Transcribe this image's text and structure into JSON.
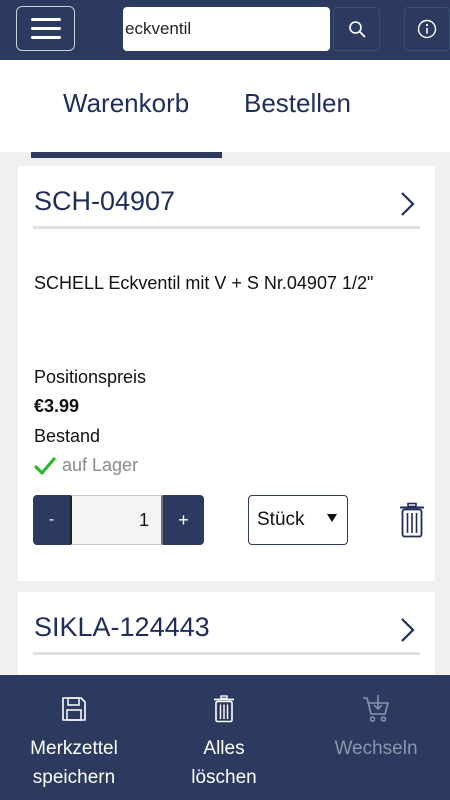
{
  "header": {
    "search": {
      "value": "eckventil",
      "placeholder": ""
    },
    "icons": {
      "menu": "hamburger-icon",
      "search": "search-icon",
      "info": "info-icon"
    }
  },
  "tabs": [
    {
      "label": "Warenkorb",
      "active": true
    },
    {
      "label": "Bestellen",
      "active": false
    }
  ],
  "cart": {
    "items": [
      {
        "sku": "SCH-04907",
        "description": "SCHELL Eckventil mit V + S Nr.04907 1/2\"",
        "price_label": "Positionspreis",
        "price": "€3.99",
        "stock_label": "Bestand",
        "stock_status": "auf Lager",
        "quantity": {
          "minus": "-",
          "value": "1",
          "plus": "+"
        },
        "unit": "Stück"
      },
      {
        "sku": "SIKLA-124443"
      }
    ]
  },
  "bottom_bar": {
    "merkzettel": {
      "line1": "Merkzettel",
      "line2": "speichern",
      "icon": "save-icon"
    },
    "alles": {
      "line1": "Alles",
      "line2": "löschen",
      "icon": "trash-icon"
    },
    "wechseln": {
      "line1": "Wechseln",
      "icon": "cart-icon",
      "disabled": true
    }
  },
  "colors": {
    "brand": "#2b3a5e",
    "background": "#f0f0f0",
    "stock_ok": "#2fb52f",
    "disabled": "#8c95ab"
  }
}
